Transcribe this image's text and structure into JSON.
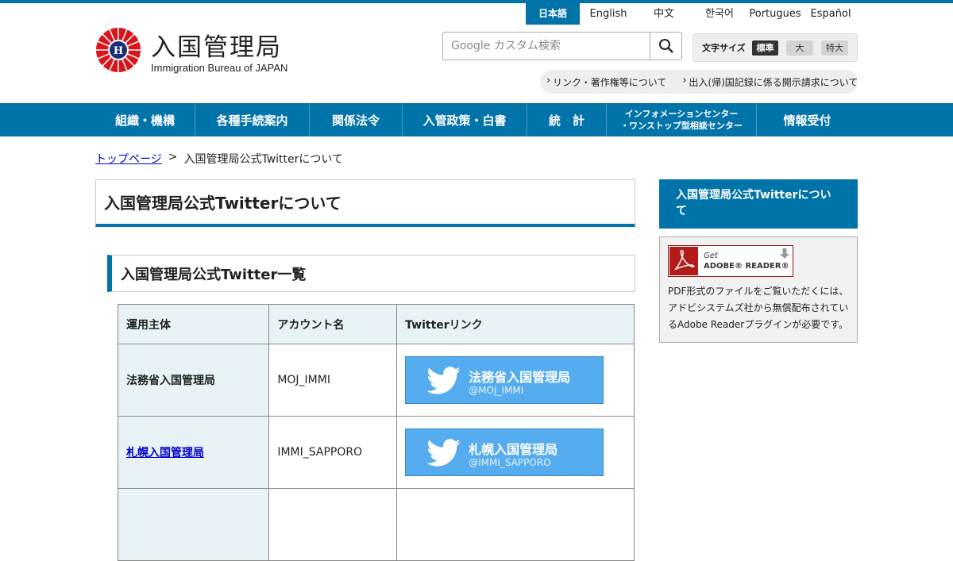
{
  "lang_bar": {
    "items": [
      {
        "label": "日本語",
        "active": true
      },
      {
        "label": "English",
        "active": false
      },
      {
        "label": "中文",
        "active": false
      },
      {
        "label": "한국어",
        "active": false
      },
      {
        "label": "Portugues",
        "active": false
      },
      {
        "label": "Español",
        "active": false
      }
    ]
  },
  "logo": {
    "title_jp": "入国管理局",
    "title_en": "Immigration Bureau of JAPAN"
  },
  "search": {
    "placeholder": "Google カスタム検索"
  },
  "font_size": {
    "label": "文字サイズ",
    "options": [
      "標準",
      "大",
      "特大"
    ],
    "selected": "標準"
  },
  "util_links": [
    "リンク・著作権等について",
    "出入(帰)国記録に係る開示請求について"
  ],
  "global_nav": [
    "組織・機構",
    "各種手続案内",
    "関係法令",
    "入管政策・白書",
    "統　計",
    "インフォメーションセンター\n・ワンストップ型相談センター",
    "情報受付"
  ],
  "breadcrumb": {
    "home": "トップページ",
    "separator": ">",
    "current": "入国管理局公式Twitterについて"
  },
  "page_title": "入国管理局公式Twitterについて",
  "section_title": "入国管理局公式Twitter一覧",
  "table": {
    "headers": [
      "運用主体",
      "アカウント名",
      "Twitterリンク"
    ],
    "rows": [
      {
        "org": "法務省入国管理局",
        "org_link": false,
        "account": "MOJ_IMMI",
        "btn_name": "法務省入国管理局",
        "btn_handle": "@MOJ_IMMI"
      },
      {
        "org": "札幌入国管理局",
        "org_link": true,
        "account": "IMMI_SAPPORO",
        "btn_name": "札幌入国管理局",
        "btn_handle": "@IMMI_SAPPORO"
      }
    ]
  },
  "sidebar": {
    "heading": "入国管理局公式Twitterについて",
    "adobe_get": "Get",
    "adobe_reader": "ADOBE® READER®",
    "pdf_note": "PDF形式のファイルをご覧いただくには、アドビシステムズ社から無償配布されているAdobe Readerプラグインが必要です。"
  },
  "colors": {
    "brand_blue": "#0073a8",
    "twitter_blue": "#55acee",
    "header_cell": "#e8f3f7"
  }
}
